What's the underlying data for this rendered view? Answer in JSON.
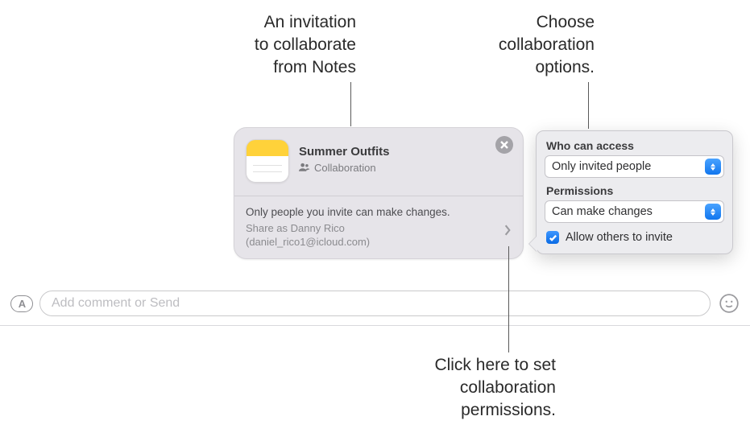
{
  "callouts": {
    "invite": "An invitation\nto collaborate\nfrom Notes",
    "options": "Choose\ncollaboration\noptions.",
    "permissions": "Click here to set\ncollaboration\npermissions."
  },
  "compose": {
    "placeholder": "Add comment or Send"
  },
  "invite_card": {
    "title": "Summer Outfits",
    "subtitle": "Collaboration",
    "info_line": "Only people you invite can make changes.",
    "share_as_line1": "Share as Danny Rico",
    "share_as_line2": "(daniel_rico1@icloud.com)"
  },
  "popover": {
    "access_label": "Who can access",
    "access_value": "Only invited people",
    "perm_label": "Permissions",
    "perm_value": "Can make changes",
    "allow_invite_label": "Allow others to invite",
    "allow_invite_checked": true
  }
}
